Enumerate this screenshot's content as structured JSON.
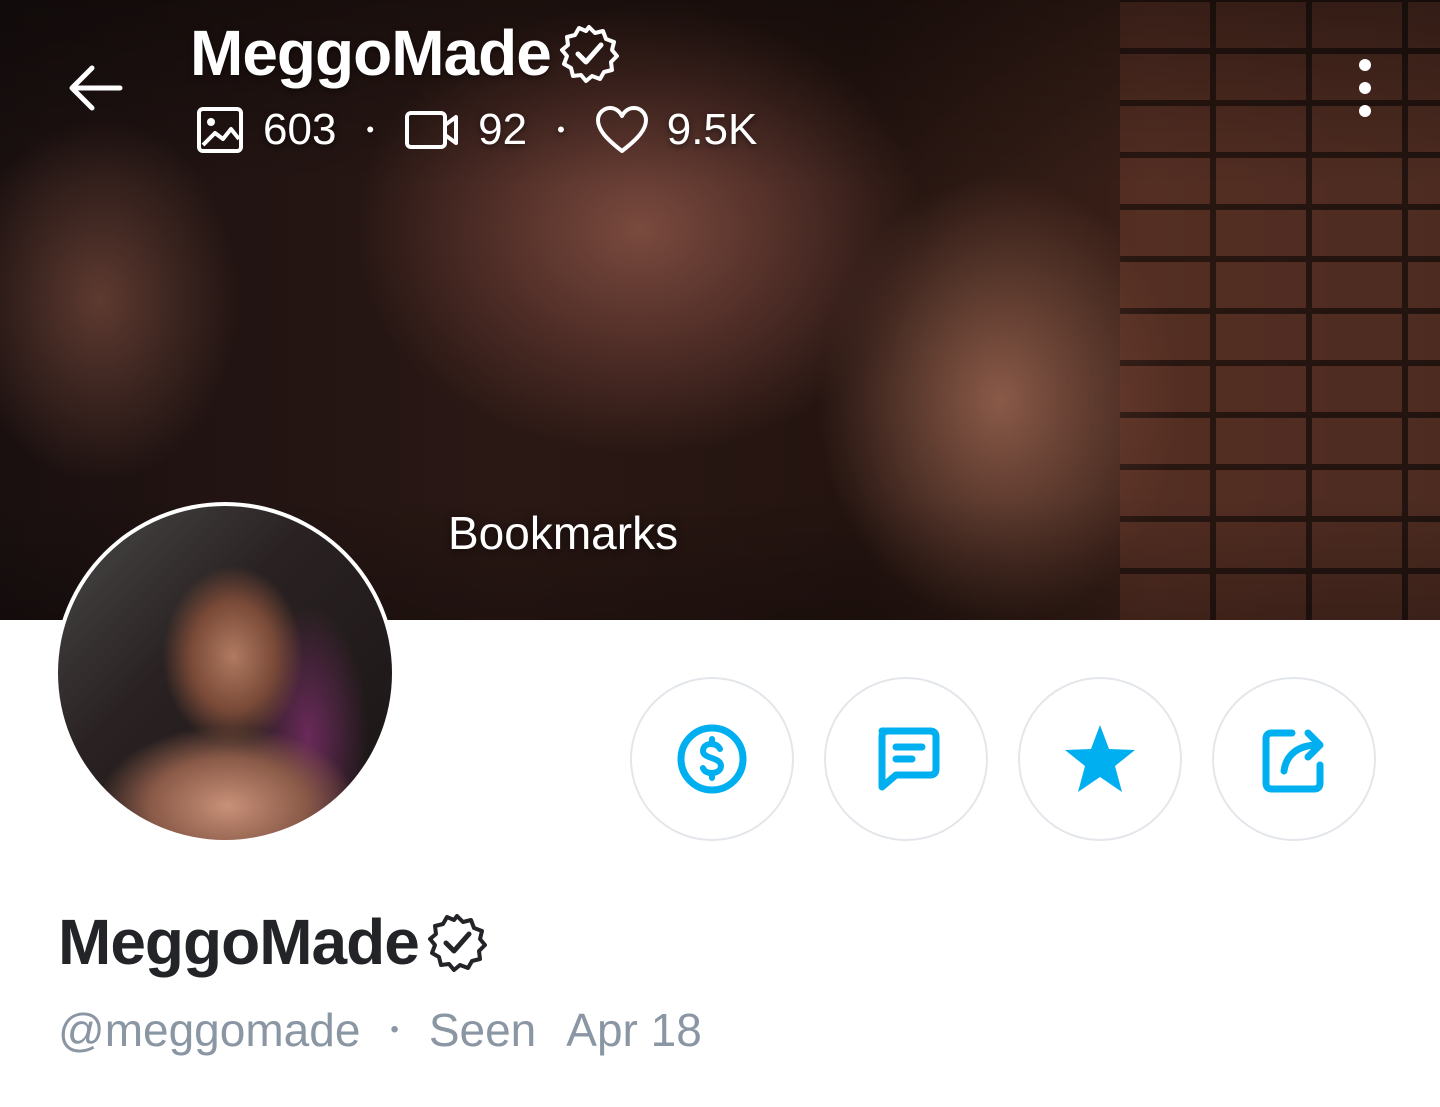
{
  "header": {
    "title": "MeggoMade",
    "stats": {
      "photos": "603",
      "videos": "92",
      "likes": "9.5K"
    }
  },
  "cover": {
    "label": "Bookmarks"
  },
  "profile": {
    "name": "MeggoMade",
    "handle": "@meggomade",
    "seen_label": "Seen",
    "seen_date": "Apr 18"
  },
  "actions": [
    {
      "name": "tip",
      "icon": "dollar-icon"
    },
    {
      "name": "message",
      "icon": "message-icon"
    },
    {
      "name": "favorite",
      "icon": "star-icon"
    },
    {
      "name": "share",
      "icon": "share-icon"
    }
  ],
  "colors": {
    "accent": "#00aff0",
    "muted_text": "#8a96a3",
    "primary_text": "#222428",
    "button_border": "#e3e6ea"
  }
}
